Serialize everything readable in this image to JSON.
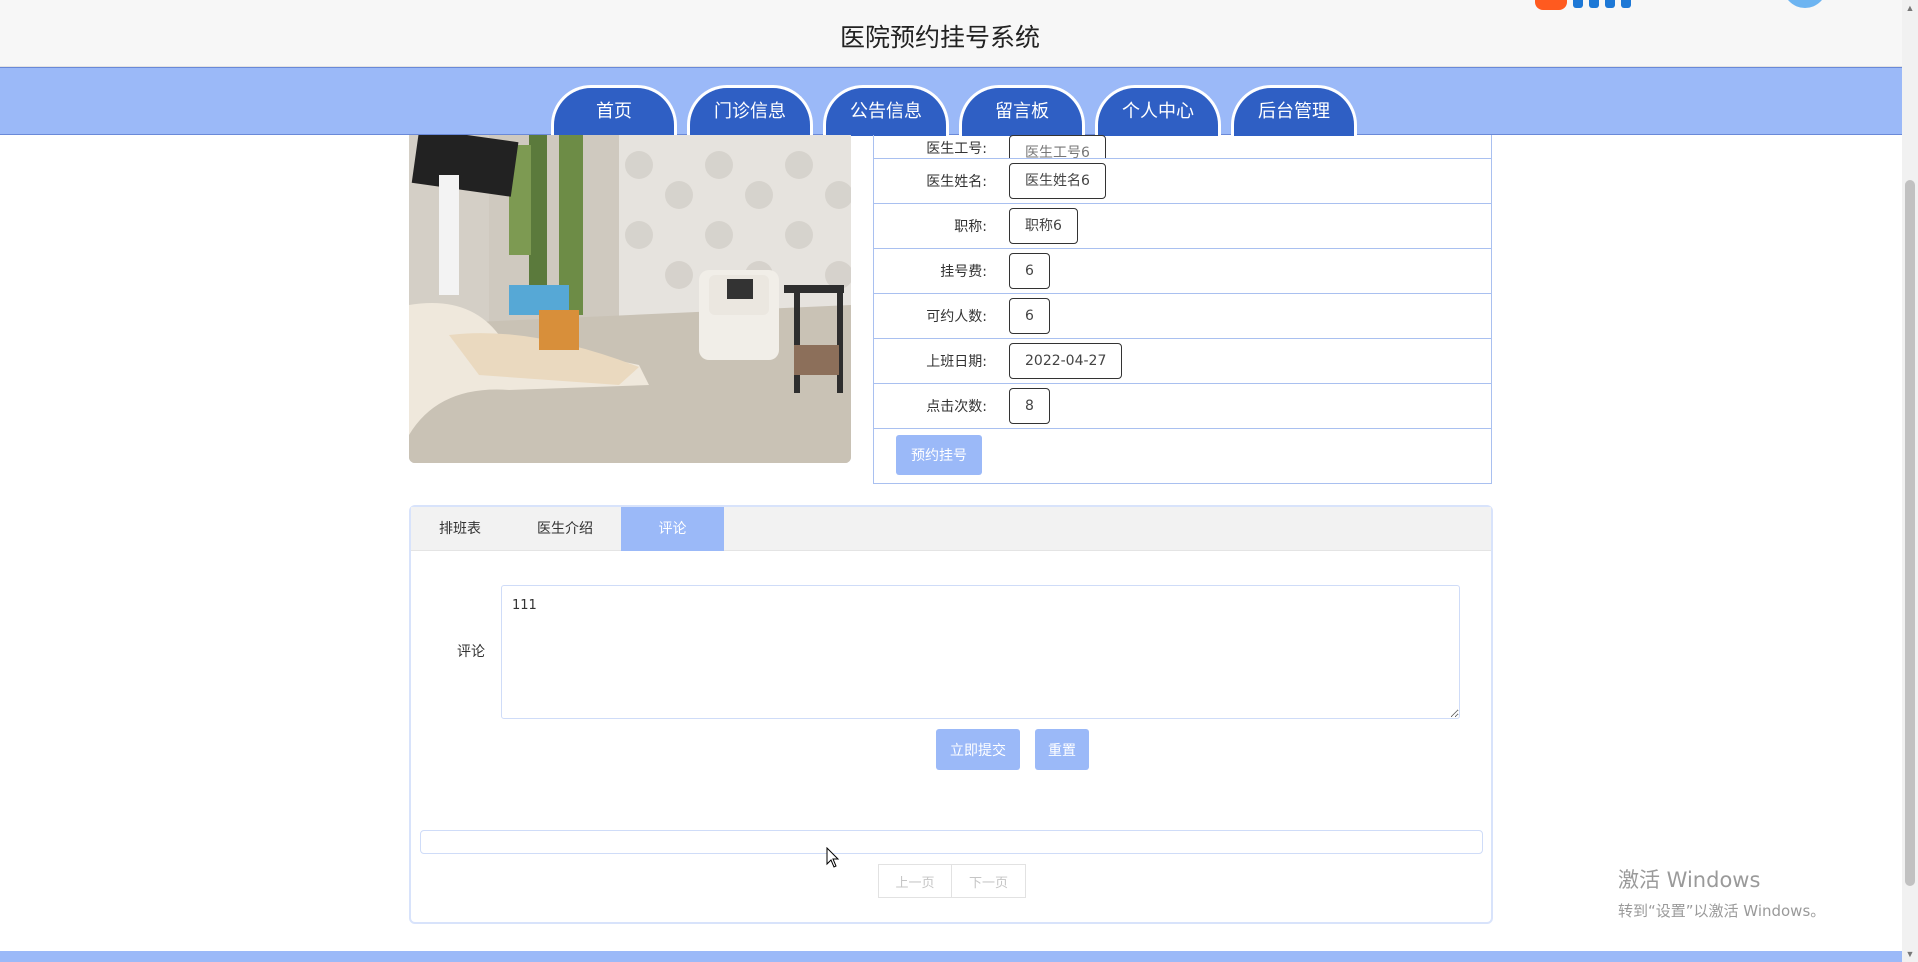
{
  "header": {
    "site_title": "医院预约挂号系统"
  },
  "nav": {
    "items": [
      {
        "label": "首页"
      },
      {
        "label": "门诊信息"
      },
      {
        "label": "公告信息"
      },
      {
        "label": "留言板"
      },
      {
        "label": "个人中心"
      },
      {
        "label": "后台管理"
      }
    ]
  },
  "doctor": {
    "fields": [
      {
        "label": "医生工号:",
        "value": "医生工号6"
      },
      {
        "label": "医生姓名:",
        "value": "医生姓名6"
      },
      {
        "label": "职称:",
        "value": "职称6"
      },
      {
        "label": "挂号费:",
        "value": "6"
      },
      {
        "label": "可约人数:",
        "value": "6"
      },
      {
        "label": "上班日期:",
        "value": "2022-04-27"
      },
      {
        "label": "点击次数:",
        "value": "8"
      }
    ],
    "book_label": "预约挂号"
  },
  "tabs": {
    "items": [
      {
        "label": "排班表"
      },
      {
        "label": "医生介绍"
      },
      {
        "label": "评论"
      }
    ],
    "active_index": 2
  },
  "comment_form": {
    "label": "评论",
    "value": "111",
    "submit_label": "立即提交",
    "reset_label": "重置"
  },
  "pager": {
    "prev_label": "上一页",
    "next_label": "下一页"
  },
  "watermark": {
    "line1": "激活 Windows",
    "line2": "转到“设置”以激活 Windows。"
  },
  "colors": {
    "nav_bg": "#9bb9f8",
    "nav_tab": "#2f5fc4",
    "accent": "#9bb9f8",
    "border": "#a9c0f0"
  }
}
